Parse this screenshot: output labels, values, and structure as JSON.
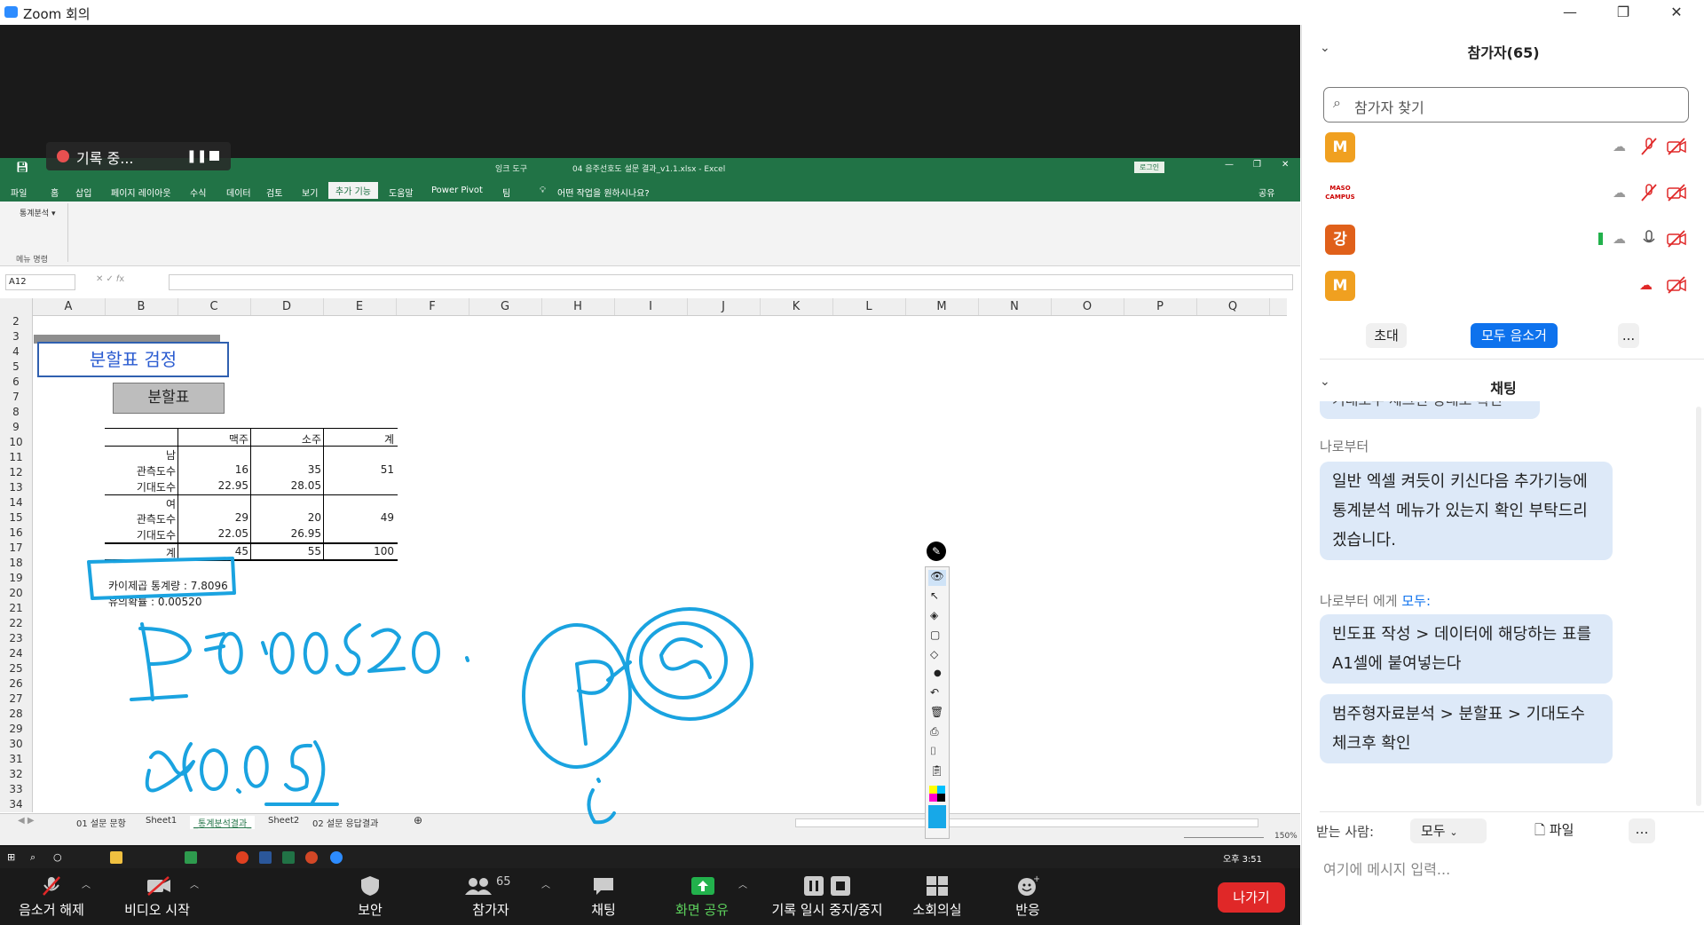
{
  "app": {
    "title": "Zoom 회의"
  },
  "excel": {
    "tabs": [
      "파일",
      "홈",
      "삽입",
      "페이지 레이아웃",
      "수식",
      "데이터",
      "검토",
      "보기",
      "추가 기능",
      "도움말",
      "Power Pivot",
      "팀"
    ],
    "tab_active": "추가 기능",
    "context_tab": "잉크 도구",
    "file_title": "04 음주선호도 설문 결과_v1.1.xlsx  -  Excel",
    "tell_me": "어떤 작업을 원하시나요?",
    "login_btn": "로그인",
    "share": "공유",
    "ribbon_item": "통계분석 ▾",
    "ribbon_group": "메뉴 명령",
    "name_box": "A12",
    "recording": "기록 중...",
    "columns": [
      "A",
      "B",
      "C",
      "D",
      "E",
      "F",
      "G",
      "H",
      "I",
      "J",
      "K",
      "L",
      "M",
      "N",
      "O",
      "P",
      "Q"
    ],
    "rows": [
      "2",
      "3",
      "4",
      "5",
      "6",
      "7",
      "8",
      "9",
      "10",
      "11",
      "12",
      "13",
      "14",
      "15",
      "16",
      "17",
      "18",
      "19",
      "20",
      "21",
      "22",
      "23",
      "24",
      "25",
      "26",
      "27",
      "28",
      "29",
      "30",
      "31",
      "32",
      "33",
      "34"
    ],
    "content": {
      "title_box": "분할표 검정",
      "button": "분할표",
      "table_header": [
        "맥주",
        "소주",
        "계"
      ],
      "group_male": "남",
      "group_female": "여",
      "obs_label": "관측도수",
      "exp_label": "기대도수",
      "total_label": "계",
      "male_obs": [
        "16",
        "35",
        "51"
      ],
      "male_exp": [
        "22.95",
        "28.05"
      ],
      "female_obs": [
        "29",
        "20",
        "49"
      ],
      "female_exp": [
        "22.05",
        "26.95"
      ],
      "totals": [
        "45",
        "55",
        "100"
      ],
      "chi_stat": "카이제곱 통계량 : 7.8096",
      "p_value": "유의확률 : 0.00520"
    },
    "sheet_tabs": [
      "01 설문 문항",
      "Sheet1",
      "_통계분석결과_",
      "Sheet2",
      "02 설문 응답결과"
    ],
    "zoom_level": "150%",
    "clock": "오후 3:51"
  },
  "toolbar": {
    "mute": "음소거 해제",
    "video": "비디오 시작",
    "security": "보안",
    "participants": "참가자",
    "participant_count": "65",
    "chat": "채팅",
    "share": "화면 공유",
    "record": "기록 일시 중지/중지",
    "breakout": "소회의실",
    "reactions": "반응",
    "leave": "나가기"
  },
  "participants_panel": {
    "title": "참가자(65)",
    "search_placeholder": "참가자 찾기",
    "items": [
      {
        "avatar": "M",
        "color": "#f0a020"
      },
      {
        "avatar": "MASO CAMPUS",
        "color": "#ffffff"
      },
      {
        "avatar": "강",
        "color": "#e0601a"
      },
      {
        "avatar": "M",
        "color": "#f0a020"
      }
    ],
    "invite": "초대",
    "mute_all": "모두 음소거",
    "more": "..."
  },
  "chat_panel": {
    "title": "채팅",
    "partial_msg": "기대도수 체크된 상태로 확인",
    "messages": [
      {
        "sender": "나로부터",
        "to": "",
        "text": "일반 엑셀 켜듯이 키신다음 추가기능에 통계분석 메뉴가 있는지 확인 부탁드리겠습니다."
      },
      {
        "sender": "나로부터 에게 ",
        "to": "모두:",
        "text": "빈도표 작성 > 데이터에 해당하는 표를 A1셀에 붙여넣는다"
      },
      {
        "sender": "",
        "to": "",
        "text": "범주형자료분석 > 분할표 > 기대도수 체크후 확인"
      }
    ],
    "recipient_label": "받는 사람:",
    "recipient": "모두",
    "file": "파일",
    "input_placeholder": "여기에 메시지 입력..."
  },
  "colors": {
    "excel_green": "#217346",
    "zoom_blue": "#0e72ed",
    "ink": "#1aa3e0",
    "leave_red": "#e02828"
  }
}
